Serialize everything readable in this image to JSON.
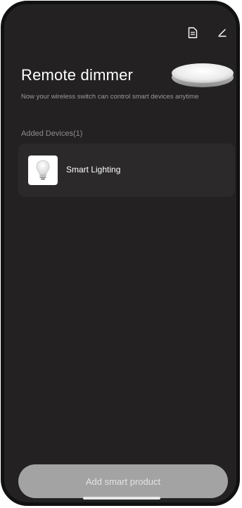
{
  "header": {
    "title": "Remote dimmer",
    "subtitle": "Now your wireless switch can control smart devices anytime",
    "icons": [
      "document-icon",
      "edit-icon"
    ]
  },
  "devices": {
    "section_label": "Added Devices(1)",
    "items": [
      {
        "name": "Smart Lighting",
        "icon": "light-bulb-icon"
      }
    ]
  },
  "footer": {
    "add_button_label": "Add smart product"
  },
  "colors": {
    "background": "#232121",
    "card": "#2b2929",
    "button": "#a3a3a3"
  }
}
